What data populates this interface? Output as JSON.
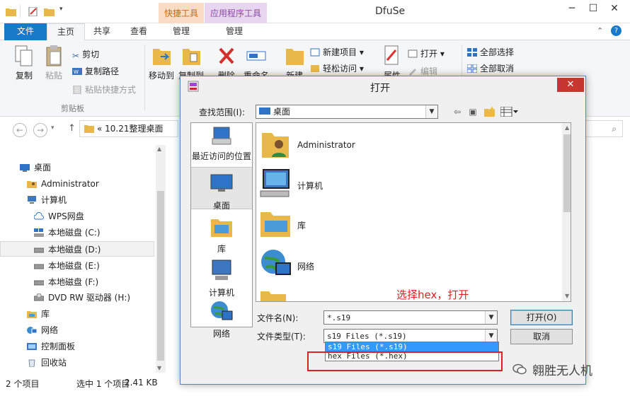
{
  "window": {
    "title": "DfuSe",
    "context_tabs": [
      "快捷工具",
      "应用程序工具"
    ],
    "context_colors": {
      "shortcut": "#f9dcc4",
      "app": "#e8d6f0"
    }
  },
  "ribbon_tabs": {
    "file": "文件",
    "home": "主页",
    "share": "共享",
    "view": "查看",
    "manage1": "管理",
    "manage2": "管理"
  },
  "ribbon": {
    "copy": "复制",
    "paste": "粘贴",
    "cut": "剪切",
    "copy_path": "复制路径",
    "paste_shortcut": "粘贴快捷方式",
    "clipboard_group": "剪贴板",
    "move_to": "移动到",
    "copy_to": "复制到",
    "delete": "删除",
    "rename": "重命名",
    "new_folder": "新建",
    "new_item": "新建项目",
    "easy_access": "轻松访问",
    "properties": "属性",
    "open": "打开",
    "edit": "编辑",
    "select_all": "全部选择",
    "select_none": "全部取消"
  },
  "address": {
    "path": "«  10.21整理桌面"
  },
  "nav": [
    {
      "label": "桌面",
      "icon": "desktop-icon"
    },
    {
      "label": "Administrator",
      "icon": "user-icon"
    },
    {
      "label": "计算机",
      "icon": "computer-icon"
    },
    {
      "label": "WPS网盘",
      "icon": "cloud-icon"
    },
    {
      "label": "本地磁盘 (C:)",
      "icon": "drive-icon"
    },
    {
      "label": "本地磁盘 (D:)",
      "icon": "drive-icon"
    },
    {
      "label": "本地磁盘 (E:)",
      "icon": "drive-icon"
    },
    {
      "label": "本地磁盘 (F:)",
      "icon": "drive-icon"
    },
    {
      "label": "DVD RW 驱动器 (H:)",
      "icon": "dvd-icon"
    },
    {
      "label": "库",
      "icon": "library-icon"
    },
    {
      "label": "网络",
      "icon": "network-icon"
    },
    {
      "label": "控制面板",
      "icon": "control-panel-icon"
    },
    {
      "label": "回收站",
      "icon": "recycle-bin-icon"
    }
  ],
  "status": {
    "count": "2 个项目",
    "selected": "选中 1 个项目",
    "size": "2.41 KB"
  },
  "dialog": {
    "title": "打开",
    "look_in_label": "查找范围(I):",
    "look_in_value": "桌面",
    "places": [
      "最近访问的位置",
      "桌面",
      "库",
      "计算机",
      "网络"
    ],
    "files": [
      "Administrator",
      "计算机",
      "库",
      "网络"
    ],
    "filename_label": "文件名(N):",
    "filename_value": "*.s19",
    "filetype_label": "文件类型(T):",
    "filetype_value": "s19 Files (*.s19)",
    "dropdown_options": [
      "s19 Files (*.s19)",
      "hex Files (*.hex)"
    ],
    "open_button": "打开(O)",
    "cancel_button": "取消"
  },
  "annotation": {
    "text": "选择hex，打开",
    "color": "#e02020"
  },
  "watermark": "翱胜无人机"
}
